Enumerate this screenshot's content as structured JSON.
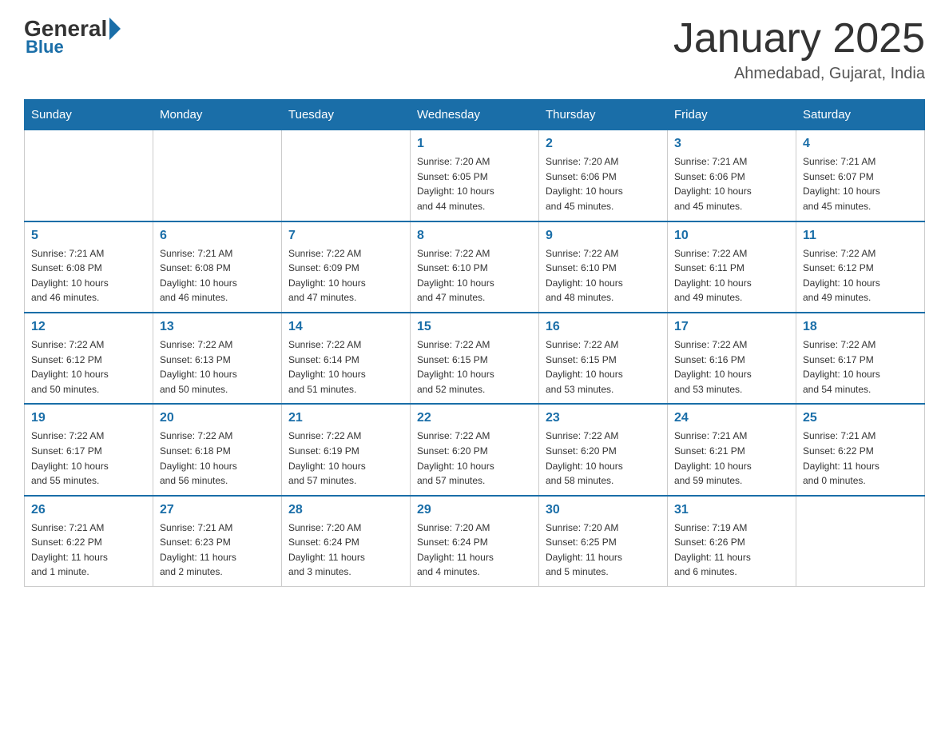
{
  "header": {
    "logo_general": "General",
    "logo_blue": "Blue",
    "month_title": "January 2025",
    "location": "Ahmedabad, Gujarat, India"
  },
  "days_of_week": [
    "Sunday",
    "Monday",
    "Tuesday",
    "Wednesday",
    "Thursday",
    "Friday",
    "Saturday"
  ],
  "weeks": [
    [
      {
        "day": "",
        "info": ""
      },
      {
        "day": "",
        "info": ""
      },
      {
        "day": "",
        "info": ""
      },
      {
        "day": "1",
        "info": "Sunrise: 7:20 AM\nSunset: 6:05 PM\nDaylight: 10 hours\nand 44 minutes."
      },
      {
        "day": "2",
        "info": "Sunrise: 7:20 AM\nSunset: 6:06 PM\nDaylight: 10 hours\nand 45 minutes."
      },
      {
        "day": "3",
        "info": "Sunrise: 7:21 AM\nSunset: 6:06 PM\nDaylight: 10 hours\nand 45 minutes."
      },
      {
        "day": "4",
        "info": "Sunrise: 7:21 AM\nSunset: 6:07 PM\nDaylight: 10 hours\nand 45 minutes."
      }
    ],
    [
      {
        "day": "5",
        "info": "Sunrise: 7:21 AM\nSunset: 6:08 PM\nDaylight: 10 hours\nand 46 minutes."
      },
      {
        "day": "6",
        "info": "Sunrise: 7:21 AM\nSunset: 6:08 PM\nDaylight: 10 hours\nand 46 minutes."
      },
      {
        "day": "7",
        "info": "Sunrise: 7:22 AM\nSunset: 6:09 PM\nDaylight: 10 hours\nand 47 minutes."
      },
      {
        "day": "8",
        "info": "Sunrise: 7:22 AM\nSunset: 6:10 PM\nDaylight: 10 hours\nand 47 minutes."
      },
      {
        "day": "9",
        "info": "Sunrise: 7:22 AM\nSunset: 6:10 PM\nDaylight: 10 hours\nand 48 minutes."
      },
      {
        "day": "10",
        "info": "Sunrise: 7:22 AM\nSunset: 6:11 PM\nDaylight: 10 hours\nand 49 minutes."
      },
      {
        "day": "11",
        "info": "Sunrise: 7:22 AM\nSunset: 6:12 PM\nDaylight: 10 hours\nand 49 minutes."
      }
    ],
    [
      {
        "day": "12",
        "info": "Sunrise: 7:22 AM\nSunset: 6:12 PM\nDaylight: 10 hours\nand 50 minutes."
      },
      {
        "day": "13",
        "info": "Sunrise: 7:22 AM\nSunset: 6:13 PM\nDaylight: 10 hours\nand 50 minutes."
      },
      {
        "day": "14",
        "info": "Sunrise: 7:22 AM\nSunset: 6:14 PM\nDaylight: 10 hours\nand 51 minutes."
      },
      {
        "day": "15",
        "info": "Sunrise: 7:22 AM\nSunset: 6:15 PM\nDaylight: 10 hours\nand 52 minutes."
      },
      {
        "day": "16",
        "info": "Sunrise: 7:22 AM\nSunset: 6:15 PM\nDaylight: 10 hours\nand 53 minutes."
      },
      {
        "day": "17",
        "info": "Sunrise: 7:22 AM\nSunset: 6:16 PM\nDaylight: 10 hours\nand 53 minutes."
      },
      {
        "day": "18",
        "info": "Sunrise: 7:22 AM\nSunset: 6:17 PM\nDaylight: 10 hours\nand 54 minutes."
      }
    ],
    [
      {
        "day": "19",
        "info": "Sunrise: 7:22 AM\nSunset: 6:17 PM\nDaylight: 10 hours\nand 55 minutes."
      },
      {
        "day": "20",
        "info": "Sunrise: 7:22 AM\nSunset: 6:18 PM\nDaylight: 10 hours\nand 56 minutes."
      },
      {
        "day": "21",
        "info": "Sunrise: 7:22 AM\nSunset: 6:19 PM\nDaylight: 10 hours\nand 57 minutes."
      },
      {
        "day": "22",
        "info": "Sunrise: 7:22 AM\nSunset: 6:20 PM\nDaylight: 10 hours\nand 57 minutes."
      },
      {
        "day": "23",
        "info": "Sunrise: 7:22 AM\nSunset: 6:20 PM\nDaylight: 10 hours\nand 58 minutes."
      },
      {
        "day": "24",
        "info": "Sunrise: 7:21 AM\nSunset: 6:21 PM\nDaylight: 10 hours\nand 59 minutes."
      },
      {
        "day": "25",
        "info": "Sunrise: 7:21 AM\nSunset: 6:22 PM\nDaylight: 11 hours\nand 0 minutes."
      }
    ],
    [
      {
        "day": "26",
        "info": "Sunrise: 7:21 AM\nSunset: 6:22 PM\nDaylight: 11 hours\nand 1 minute."
      },
      {
        "day": "27",
        "info": "Sunrise: 7:21 AM\nSunset: 6:23 PM\nDaylight: 11 hours\nand 2 minutes."
      },
      {
        "day": "28",
        "info": "Sunrise: 7:20 AM\nSunset: 6:24 PM\nDaylight: 11 hours\nand 3 minutes."
      },
      {
        "day": "29",
        "info": "Sunrise: 7:20 AM\nSunset: 6:24 PM\nDaylight: 11 hours\nand 4 minutes."
      },
      {
        "day": "30",
        "info": "Sunrise: 7:20 AM\nSunset: 6:25 PM\nDaylight: 11 hours\nand 5 minutes."
      },
      {
        "day": "31",
        "info": "Sunrise: 7:19 AM\nSunset: 6:26 PM\nDaylight: 11 hours\nand 6 minutes."
      },
      {
        "day": "",
        "info": ""
      }
    ]
  ]
}
